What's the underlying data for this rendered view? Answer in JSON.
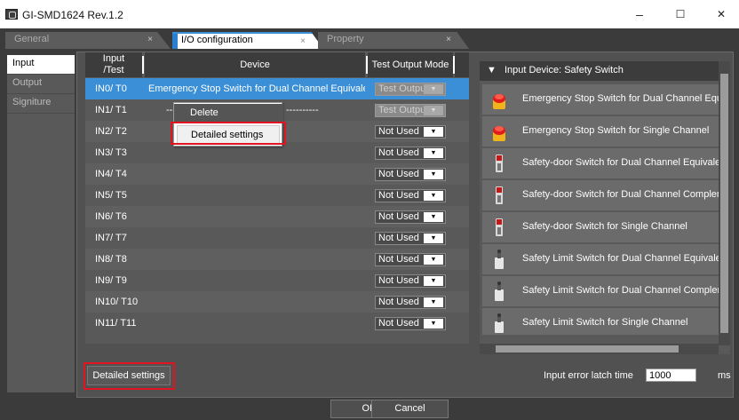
{
  "window": {
    "title": "GI-SMD1624 Rev.1.2",
    "minimize": "–",
    "maximize": "☐",
    "close": "✕"
  },
  "tabs": [
    {
      "label": "General",
      "close": "×"
    },
    {
      "label": "I/O configuration",
      "close": "×"
    },
    {
      "label": "Property",
      "close": "×"
    }
  ],
  "sidebar": {
    "items": [
      {
        "label": "Input"
      },
      {
        "label": "Output"
      },
      {
        "label": "Signiture"
      }
    ]
  },
  "grid": {
    "headers": {
      "io_line1": "Input",
      "io_line2": "/Test",
      "device": "Device",
      "mode": "Test Output Mode"
    },
    "rows": [
      {
        "io": "IN0/ T0",
        "device": "Emergency Stop Switch for Dual Channel Equivalent",
        "mode": "Test Output"
      },
      {
        "io": "IN1/ T1",
        "device": "",
        "mode": "Test Output"
      },
      {
        "io": "IN2/ T2",
        "device": "",
        "mode": "Not Used"
      },
      {
        "io": "IN3/ T3",
        "device": "",
        "mode": "Not Used"
      },
      {
        "io": "IN4/ T4",
        "device": "",
        "mode": "Not Used"
      },
      {
        "io": "IN5/ T5",
        "device": "",
        "mode": "Not Used"
      },
      {
        "io": "IN6/ T6",
        "device": "",
        "mode": "Not Used"
      },
      {
        "io": "IN7/ T7",
        "device": "",
        "mode": "Not Used"
      },
      {
        "io": "IN8/ T8",
        "device": "",
        "mode": "Not Used"
      },
      {
        "io": "IN9/ T9",
        "device": "",
        "mode": "Not Used"
      },
      {
        "io": "IN10/ T10",
        "device": "",
        "mode": "Not Used"
      },
      {
        "io": "IN11/ T11",
        "device": "",
        "mode": "Not Used"
      }
    ],
    "dropdown_arrow": "▼",
    "dashes_left": "---",
    "dashes_right": "----------"
  },
  "context_menu": {
    "delete": "Delete",
    "detailed": "Detailed settings"
  },
  "detailed_button": "Detailed settings",
  "library": {
    "header_arrow": "▼",
    "header": "Input Device: Safety Switch",
    "items": [
      {
        "label": "Emergency Stop Switch for Dual Channel Equivalent",
        "icon": "estop-icon"
      },
      {
        "label": "Emergency Stop Switch for Single Channel",
        "icon": "estop-icon"
      },
      {
        "label": "Safety-door Switch for Dual Channel Equivalent",
        "icon": "door-switch-icon"
      },
      {
        "label": "Safety-door Switch for Dual Channel Complementary",
        "icon": "door-switch-icon"
      },
      {
        "label": "Safety-door Switch for Single Channel",
        "icon": "door-switch-icon"
      },
      {
        "label": "Safety Limit Switch for Dual Channel Equivalent",
        "icon": "limit-switch-icon"
      },
      {
        "label": "Safety Limit Switch for Dual Channel Complementary",
        "icon": "limit-switch-icon"
      },
      {
        "label": "Safety Limit Switch for Single Channel",
        "icon": "limit-switch-icon"
      }
    ]
  },
  "latch": {
    "label": "Input error latch time",
    "value": "1000",
    "unit": "ms"
  },
  "buttons": {
    "ok": "OK",
    "cancel": "Cancel"
  }
}
